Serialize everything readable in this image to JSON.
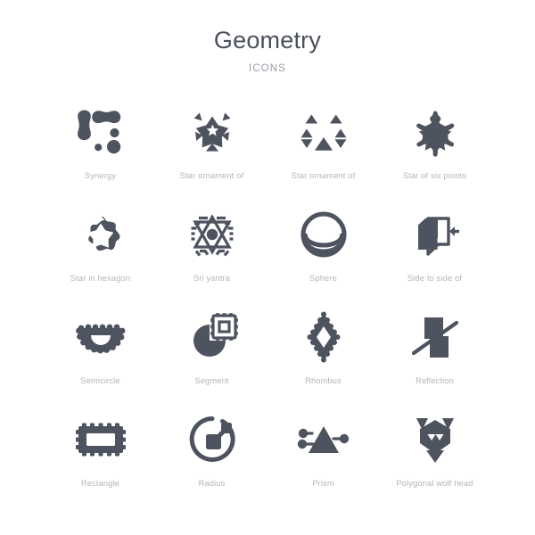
{
  "header": {
    "title": "Geometry",
    "subtitle": "icons"
  },
  "palette": {
    "icon_fill": "#4e5360",
    "background": "#ffffff",
    "title_color": "#4a4f5c",
    "subtitle_color": "#9a9da5",
    "label_color": "#b2b5bb"
  },
  "grid": {
    "columns": 4,
    "rows": 4,
    "items": [
      {
        "label": "Synergy",
        "icon": "synergy-icon"
      },
      {
        "label": "Star ornament of",
        "icon": "star-ornament-triangles-icon"
      },
      {
        "label": "Star ornament of",
        "icon": "star-ornament-outline-triangles-icon"
      },
      {
        "label": "Star of six points",
        "icon": "star-of-six-points-icon"
      },
      {
        "label": "Star in hexagon",
        "icon": "star-in-hexagon-icon"
      },
      {
        "label": "Sri yantra",
        "icon": "sri-yantra-icon"
      },
      {
        "label": "Sphere",
        "icon": "sphere-icon"
      },
      {
        "label": "Side to side of",
        "icon": "side-to-side-of-icon"
      },
      {
        "label": "Semicircle",
        "icon": "semicircle-icon"
      },
      {
        "label": "Segment",
        "icon": "segment-icon"
      },
      {
        "label": "Rhombus",
        "icon": "rhombus-icon"
      },
      {
        "label": "Reflection",
        "icon": "reflection-icon"
      },
      {
        "label": "Rectangle",
        "icon": "rectangle-icon"
      },
      {
        "label": "Radius",
        "icon": "radius-icon"
      },
      {
        "label": "Prism",
        "icon": "prism-icon"
      },
      {
        "label": "Polygonal wolf head",
        "icon": "polygonal-wolf-head-icon"
      }
    ]
  }
}
